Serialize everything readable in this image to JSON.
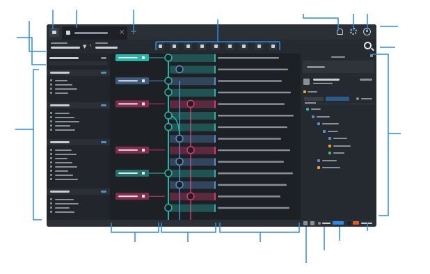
{
  "colors": {
    "chrome": "#2b2f36",
    "panel": "#22262c",
    "graph_bg": "#1d2126",
    "teal": "#2bb3a6",
    "blue": "#5a8cc7",
    "pink": "#d7396d",
    "orange": "#f0a23a",
    "green": "#4cb37a",
    "callout": "#2c8ae6",
    "placeholder": "#8a9099"
  },
  "icons": {
    "tabs": [
      "app-icon",
      "tab-icon",
      "close-icon",
      "plus-icon"
    ],
    "header": [
      "bell-icon",
      "gear-icon",
      "user-icon"
    ],
    "toolbar": [
      "chevron-down-icon",
      "chevron-right-icon",
      "search-icon"
    ]
  },
  "toolbar_buttons": 9,
  "sidebar": {
    "sections": [
      {
        "kind": "repo",
        "items": 4
      },
      {
        "kind": "branches",
        "items": 5
      },
      {
        "kind": "remotes",
        "items": 8
      },
      {
        "kind": "tags",
        "items": 4
      }
    ]
  },
  "graph": {
    "lanes": [
      "teal",
      "blue",
      "pink"
    ],
    "commits": 14,
    "branch_labels": [
      {
        "row": 0,
        "color": "teal"
      },
      {
        "row": 2,
        "color": "blue"
      },
      {
        "row": 4,
        "color": "pink"
      },
      {
        "row": 8,
        "color": "pink"
      },
      {
        "row": 10,
        "color": "teal"
      },
      {
        "row": 12,
        "color": "pink"
      }
    ]
  },
  "detail_tree": {
    "nodes": [
      {
        "depth": 0,
        "color": "teal"
      },
      {
        "depth": 1,
        "color": "blue"
      },
      {
        "depth": 2,
        "color": "blue"
      },
      {
        "depth": 3,
        "color": "blue"
      },
      {
        "depth": 4,
        "color": "blue"
      },
      {
        "depth": 4,
        "color": "orange"
      },
      {
        "depth": 4,
        "color": "green"
      },
      {
        "depth": 2,
        "color": "blue"
      },
      {
        "depth": 2,
        "color": "orange"
      }
    ]
  },
  "statusbar": {
    "segments": 6,
    "accent_colors": [
      "#2c8ae6",
      "#e0591d"
    ]
  },
  "callouts": 18
}
